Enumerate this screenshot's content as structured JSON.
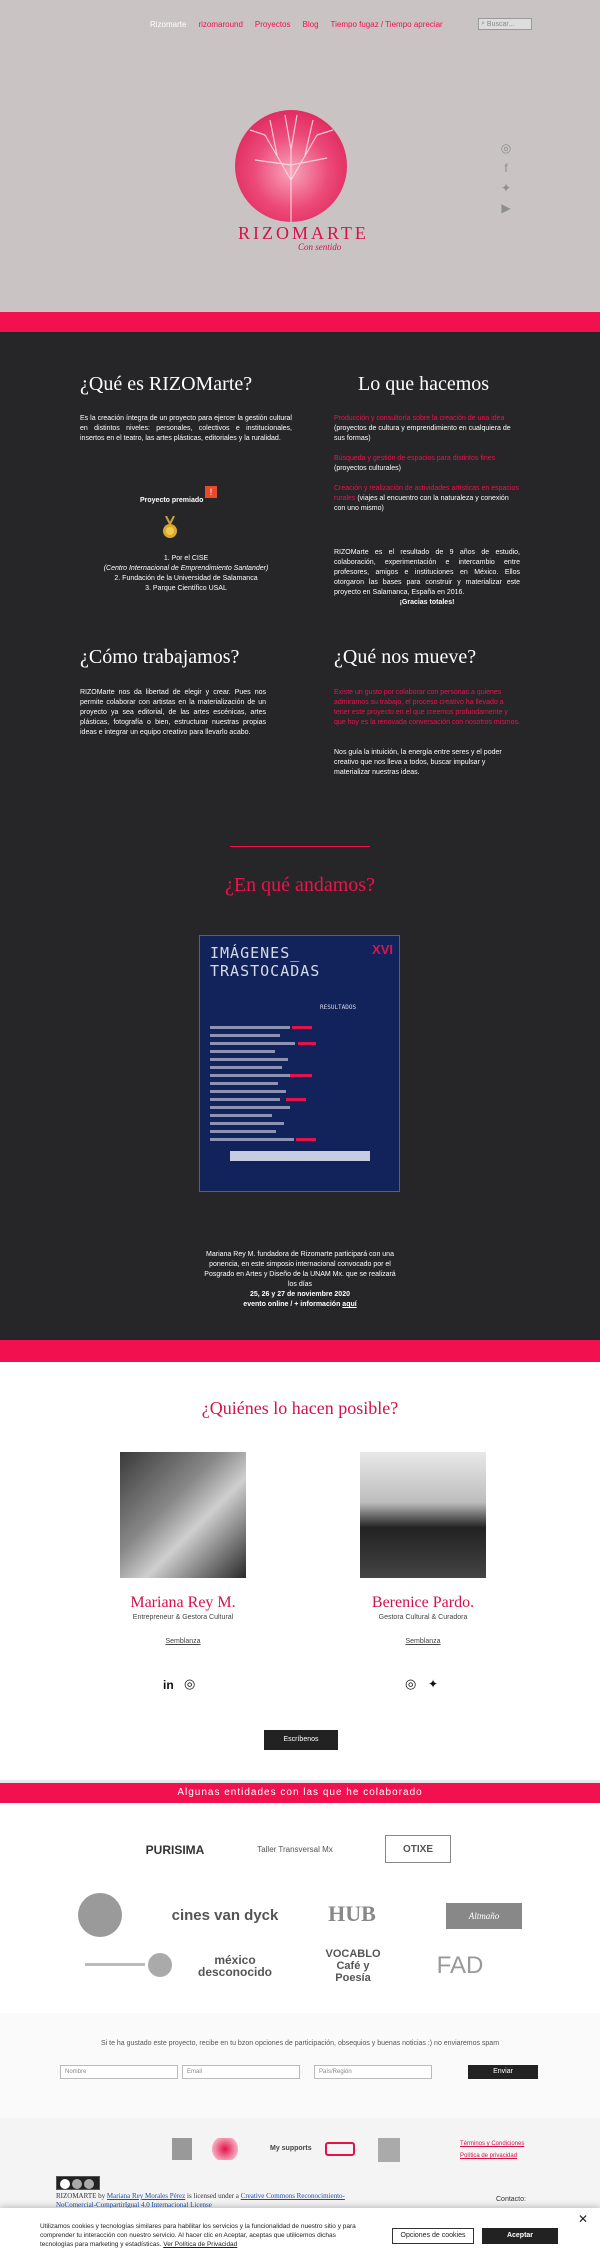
{
  "nav": {
    "items": [
      "Rizomarte",
      "rizomaround",
      "Proyectos",
      "Blog",
      "Tiempo fugaz / Tiempo apreciar"
    ],
    "search_placeholder": "Buscar..."
  },
  "brand": {
    "title": "RIZOMARTE",
    "subtitle": "Con sentido"
  },
  "social_icons": [
    "instagram-icon",
    "facebook-icon",
    "twitter-icon",
    "youtube-icon"
  ],
  "what": {
    "heading": "¿Qué es RIZOMarte?",
    "body": "Es la creación íntegra de un proyecto para ejercer la gestión cultural en distintos niveles: personales, colectivos e institucionales, insertos en el teatro, las artes plásticas, editoriales y la ruralidad.",
    "award_label": "Proyecto premiado",
    "awards": [
      "1. Por el CISE",
      "(Centro Internacional de Emprendimiento Santander)",
      "2. Fundación de la Universidad de Salamanca",
      "3. Parque Científico USAL"
    ]
  },
  "do": {
    "heading": "Lo que hacemos",
    "items": [
      {
        "highlight": "Producción y consultoría sobre la creación de una idea",
        "rest": " (proyectos de cultura y emprendimiento en cualquiera de sus formas)"
      },
      {
        "highlight": "Búsqueda y gestión de espacios para distintos fines",
        "rest": " (proyectos culturales)"
      },
      {
        "highlight": "Creación y realización de actividades artísticas en espacios rurales",
        "rest": " (viajes al encuentro con la naturaleza y conexión con uno mismo)"
      }
    ],
    "result_text": "RIZOMarte es el resultado de 9 años de estudio, colaboración, experimentación e intercambio entre profesores, amigos e instituciones en México. Ellos otorgaron las bases para construir y materializar este proyecto en Salamanca, España en 2016.",
    "thanks": "¡Gracias totales!"
  },
  "how": {
    "heading": "¿Cómo trabajamos?",
    "body": "RIZOMarte nos da libertad de elegir y crear. Pues nos permite colaborar con artistas en la materialización de un proyecto ya sea editorial, de las artes escénicas, artes plásticas, fotografía o bien, estructurar nuestras propias ideas e integrar un equipo creativo para llevarlo acabo."
  },
  "moves": {
    "heading": "¿Qué nos mueve?",
    "highlight": "Existe un gusto por colaborar con personas a quienes admiramos su trabajo, el proceso creativo ha llevado a tener este proyecto en el que creemos profundamente y que hoy es la renovada conversación con nosotros mismos.",
    "body": "Nos guía la intuición, la energía entre seres y el poder creativo que nos lleva a todos, buscar impulsar y materializar nuestras ideas."
  },
  "doing": {
    "heading": "¿En qué andamos?",
    "poster_title_1": "IMÁGENES_",
    "poster_title_2": "TRASTOCADAS",
    "poster_badge": "XVI",
    "poster_results": "RESULTADOS",
    "caption": "Mariana Rey M. fundadora de Rizomarte participará con una ponencia, en este simposio internacional convocado por el Posgrado en Artes y Diseño de la UNAM Mx. que se realizará los días",
    "dates": "25, 26 y 27 de noviembre 2020",
    "event": "evento online / + información",
    "link": "aquí"
  },
  "who": {
    "heading": "¿Quiénes lo hacen posible?",
    "people": [
      {
        "name": "Mariana Rey M.",
        "role": "Entrepreneur & Gestora Cultural",
        "link": "Semblanza"
      },
      {
        "name": "Berenice Pardo.",
        "role": "Gestora Cultural & Curadora",
        "link": "Semblanza"
      }
    ],
    "contact_button": "Escríbenos"
  },
  "entities": {
    "heading": "Algunas entidades con las que he colaborado",
    "logos": [
      "PURISIMA",
      "Taller Transversal Mx",
      "OTIXE",
      "cines van dyck",
      "HUB",
      "Altmaño",
      "méxico desconocido",
      "VOCABLO Café y Poesía",
      "FAD"
    ]
  },
  "newsletter": {
    "text": "Si te ha gustado este proyecto, recibe en tu bzon opciones de participación, obsequios y buenas noticias :) no enviaremos spam",
    "placeholders": [
      "Nombre",
      "Email",
      "País/Región"
    ],
    "button": "Enviar"
  },
  "footer": {
    "supports": "My supports",
    "links": [
      "Términos y Condiciones",
      "Política de privacidad"
    ],
    "license_1": "RIZOMARTE",
    "license_2": " by ",
    "license_author": "Mariana Rey Morales Pérez",
    "license_3": " is licensed under a ",
    "license_link": "Creative Commons Reconocimiento-NoComercial-CompartirIgual 4.0 Internacional License",
    "contact": "Contacto:"
  },
  "cookie": {
    "text": "Utilizamos cookies y tecnologías similares para habilitar los servicios y la funcionalidad de nuestro sitio y para comprender tu interacción con nuestro servicio. Al hacer clic en Aceptar, aceptas que utilicemos dichas tecnologías para marketing y estadísticas.",
    "policy_link": "Ver Política de Privacidad",
    "options": "Opciones de cookies",
    "accept": "Aceptar"
  }
}
